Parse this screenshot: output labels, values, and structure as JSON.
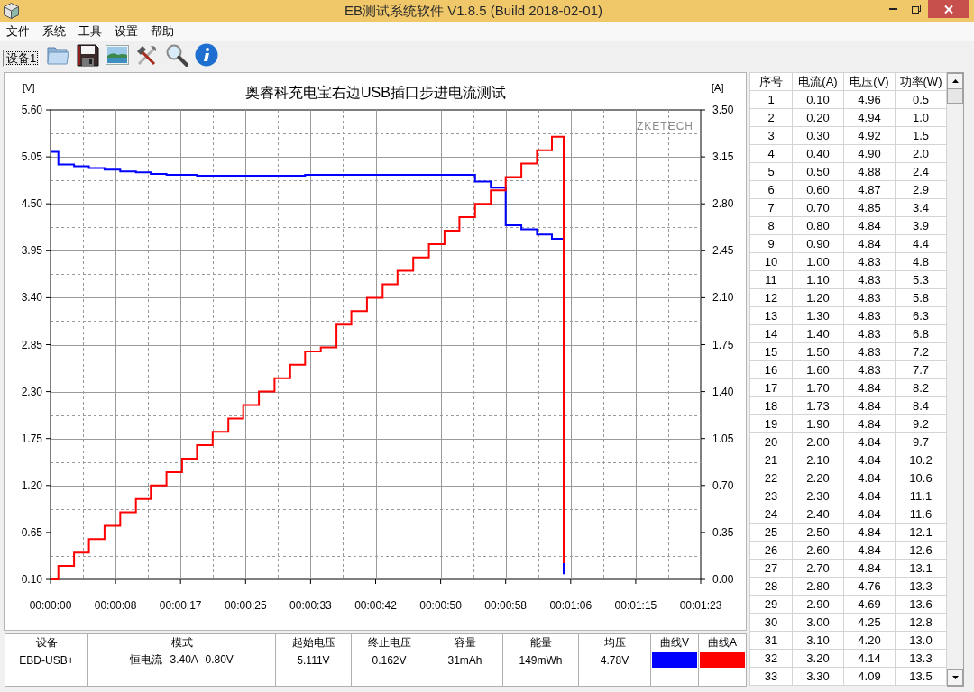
{
  "window": {
    "title": "EB测试系统软件 V1.8.5 (Build 2018-02-01)"
  },
  "menu": [
    "文件",
    "系统",
    "工具",
    "设置",
    "帮助"
  ],
  "toolbar": {
    "device_tab": {
      "label": "设备1",
      "selected": true
    }
  },
  "chart": {
    "chart_data": [
      {
        "type": "step",
        "title": "奥睿科充电宝右边USB插口步进电流测试",
        "ylabel": "[V]",
        "y2label": "[A]",
        "grid": true,
        "annotations": [
          "ZKETECH"
        ],
        "xlim": [
          0,
          83
        ],
        "xticks": [
          {
            "value": 0,
            "label": "00:00:00"
          },
          {
            "value": 8.3,
            "label": "00:00:08"
          },
          {
            "value": 16.6,
            "label": "00:00:17"
          },
          {
            "value": 24.9,
            "label": "00:00:25"
          },
          {
            "value": 33.2,
            "label": "00:00:33"
          },
          {
            "value": 41.5,
            "label": "00:00:42"
          },
          {
            "value": 49.8,
            "label": "00:00:50"
          },
          {
            "value": 58.1,
            "label": "00:00:58"
          },
          {
            "value": 66.4,
            "label": "00:01:06"
          },
          {
            "value": 74.7,
            "label": "00:01:15"
          },
          {
            "value": 83,
            "label": "00:01:23"
          }
        ],
        "ylim": [
          0.1,
          5.6
        ],
        "yticks": [
          {
            "value": 0.1,
            "label": "0.10"
          },
          {
            "value": 0.65,
            "label": "0.65"
          },
          {
            "value": 1.2,
            "label": "1.20"
          },
          {
            "value": 1.75,
            "label": "1.75"
          },
          {
            "value": 2.3,
            "label": "2.30"
          },
          {
            "value": 2.85,
            "label": "2.85"
          },
          {
            "value": 3.4,
            "label": "3.40"
          },
          {
            "value": 3.95,
            "label": "3.95"
          },
          {
            "value": 4.5,
            "label": "4.50"
          },
          {
            "value": 5.05,
            "label": "5.05"
          },
          {
            "value": 5.6,
            "label": "5.60"
          }
        ],
        "y2lim": [
          0,
          3.5
        ],
        "y2ticks": [
          {
            "value": 0,
            "label": "0.00"
          },
          {
            "value": 0.35,
            "label": "0.35"
          },
          {
            "value": 0.7,
            "label": "0.70"
          },
          {
            "value": 1.05,
            "label": "1.05"
          },
          {
            "value": 1.4,
            "label": "1.40"
          },
          {
            "value": 1.75,
            "label": "1.75"
          },
          {
            "value": 2.1,
            "label": "2.10"
          },
          {
            "value": 2.45,
            "label": "2.45"
          },
          {
            "value": 2.8,
            "label": "2.80"
          },
          {
            "value": 3.15,
            "label": "3.15"
          },
          {
            "value": 3.5,
            "label": "3.50"
          }
        ],
        "x": [
          0,
          1,
          3,
          4.9,
          6.9,
          8.9,
          10.9,
          12.8,
          14.8,
          16.8,
          18.7,
          20.7,
          22.7,
          24.6,
          26.6,
          28.6,
          30.6,
          32.5,
          34.5,
          36.5,
          38.4,
          40.4,
          42.4,
          44.3,
          46.3,
          48.3,
          50.3,
          52.2,
          54.2,
          56.2,
          58.1,
          60.1,
          62.1,
          64,
          65.5
        ],
        "series": [
          {
            "color": "#0000ff",
            "values": [
              5.11,
              4.96,
              4.94,
              4.92,
              4.9,
              4.88,
              4.87,
              4.85,
              4.84,
              4.84,
              4.83,
              4.83,
              4.83,
              4.83,
              4.83,
              4.83,
              4.83,
              4.84,
              4.84,
              4.84,
              4.84,
              4.84,
              4.84,
              4.84,
              4.84,
              4.84,
              4.84,
              4.84,
              4.76,
              4.69,
              4.25,
              4.2,
              4.14,
              4.09,
              0.16
            ]
          },
          {
            "color": "#ff0000",
            "axis": "y2",
            "values": [
              0,
              0.1,
              0.2,
              0.3,
              0.4,
              0.5,
              0.6,
              0.7,
              0.8,
              0.9,
              1.0,
              1.1,
              1.2,
              1.3,
              1.4,
              1.5,
              1.6,
              1.7,
              1.73,
              1.9,
              2.0,
              2.1,
              2.2,
              2.3,
              2.4,
              2.5,
              2.6,
              2.7,
              2.8,
              2.9,
              3.0,
              3.1,
              3.2,
              3.3,
              0.12
            ]
          }
        ]
      }
    ]
  },
  "summary_table": {
    "columns": [
      "设备",
      "模式",
      "起始电压",
      "终止电压",
      "容量",
      "能量",
      "均压",
      "曲线V",
      "曲线A"
    ],
    "rows": [
      [
        {
          "kind": "text",
          "text": "EBD-USB+"
        },
        {
          "kind": "text",
          "text": "恒电流 3.40A 0.80V"
        },
        {
          "kind": "text",
          "text": "5.111V"
        },
        {
          "kind": "text",
          "text": "0.162V"
        },
        {
          "kind": "text",
          "text": "31mAh"
        },
        {
          "kind": "text",
          "text": "149mWh"
        },
        {
          "kind": "text",
          "text": "4.78V"
        },
        {
          "kind": "swatch",
          "color": "#0000ff"
        },
        {
          "kind": "swatch",
          "color": "#ff0000"
        }
      ]
    ]
  },
  "readings_table": {
    "columns": [
      "序号",
      "电流(A)",
      "电压(V)",
      "功率(W)"
    ],
    "rows": [
      [
        "1",
        "0.10",
        "4.96",
        "0.5"
      ],
      [
        "2",
        "0.20",
        "4.94",
        "1.0"
      ],
      [
        "3",
        "0.30",
        "4.92",
        "1.5"
      ],
      [
        "4",
        "0.40",
        "4.90",
        "2.0"
      ],
      [
        "5",
        "0.50",
        "4.88",
        "2.4"
      ],
      [
        "6",
        "0.60",
        "4.87",
        "2.9"
      ],
      [
        "7",
        "0.70",
        "4.85",
        "3.4"
      ],
      [
        "8",
        "0.80",
        "4.84",
        "3.9"
      ],
      [
        "9",
        "0.90",
        "4.84",
        "4.4"
      ],
      [
        "10",
        "1.00",
        "4.83",
        "4.8"
      ],
      [
        "11",
        "1.10",
        "4.83",
        "5.3"
      ],
      [
        "12",
        "1.20",
        "4.83",
        "5.8"
      ],
      [
        "13",
        "1.30",
        "4.83",
        "6.3"
      ],
      [
        "14",
        "1.40",
        "4.83",
        "6.8"
      ],
      [
        "15",
        "1.50",
        "4.83",
        "7.2"
      ],
      [
        "16",
        "1.60",
        "4.83",
        "7.7"
      ],
      [
        "17",
        "1.70",
        "4.84",
        "8.2"
      ],
      [
        "18",
        "1.73",
        "4.84",
        "8.4"
      ],
      [
        "19",
        "1.90",
        "4.84",
        "9.2"
      ],
      [
        "20",
        "2.00",
        "4.84",
        "9.7"
      ],
      [
        "21",
        "2.10",
        "4.84",
        "10.2"
      ],
      [
        "22",
        "2.20",
        "4.84",
        "10.6"
      ],
      [
        "23",
        "2.30",
        "4.84",
        "11.1"
      ],
      [
        "24",
        "2.40",
        "4.84",
        "11.6"
      ],
      [
        "25",
        "2.50",
        "4.84",
        "12.1"
      ],
      [
        "26",
        "2.60",
        "4.84",
        "12.6"
      ],
      [
        "27",
        "2.70",
        "4.84",
        "13.1"
      ],
      [
        "28",
        "2.80",
        "4.76",
        "13.3"
      ],
      [
        "29",
        "2.90",
        "4.69",
        "13.6"
      ],
      [
        "30",
        "3.00",
        "4.25",
        "12.8"
      ],
      [
        "31",
        "3.10",
        "4.20",
        "13.0"
      ],
      [
        "32",
        "3.20",
        "4.14",
        "13.3"
      ],
      [
        "33",
        "3.30",
        "4.09",
        "13.5"
      ]
    ]
  }
}
